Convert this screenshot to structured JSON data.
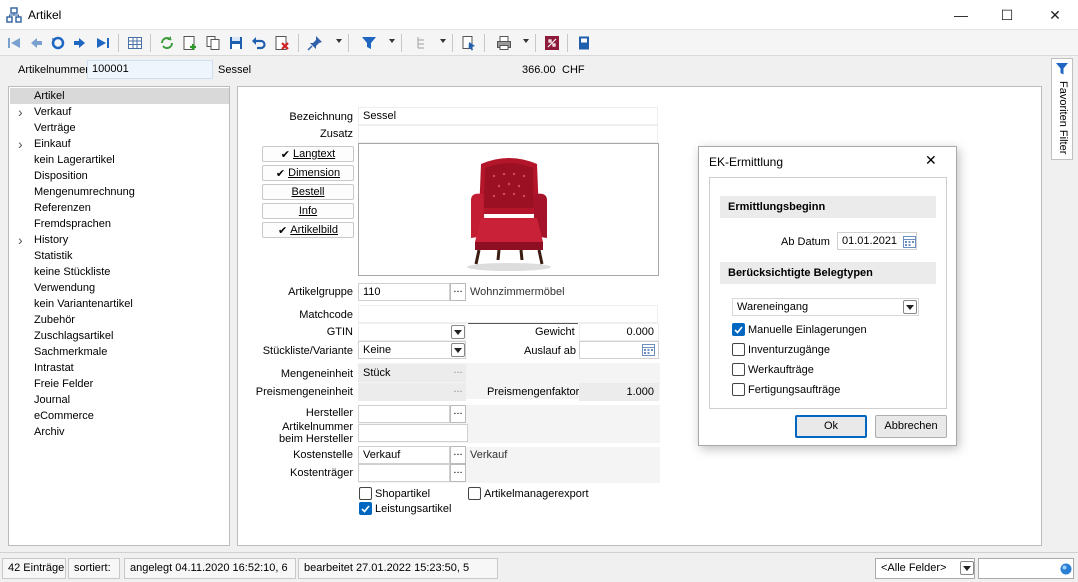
{
  "window": {
    "title": "Artikel",
    "minimize": "—",
    "maximize": "☐",
    "close": "✕"
  },
  "artikel": {
    "nummer_label": "Artikelnummer",
    "nummer": "100001",
    "name": "Sessel",
    "preis": "366.00",
    "waehrung": "CHF"
  },
  "nav": {
    "items": [
      {
        "label": "Artikel",
        "expand": false,
        "selected": true
      },
      {
        "label": "Verkauf",
        "expand": true
      },
      {
        "label": "Verträge",
        "expand": false
      },
      {
        "label": "Einkauf",
        "expand": true
      },
      {
        "label": "kein Lagerartikel",
        "expand": false
      },
      {
        "label": "Disposition",
        "expand": false
      },
      {
        "label": "Mengenumrechnung",
        "expand": false
      },
      {
        "label": "Referenzen",
        "expand": false
      },
      {
        "label": "Fremdsprachen",
        "expand": false
      },
      {
        "label": "History",
        "expand": true
      },
      {
        "label": "Statistik",
        "expand": false
      },
      {
        "label": "keine Stückliste",
        "expand": false
      },
      {
        "label": "Verwendung",
        "expand": false
      },
      {
        "label": "kein Variantenartikel",
        "expand": false
      },
      {
        "label": "Zubehör",
        "expand": false
      },
      {
        "label": "Zuschlagsartikel",
        "expand": false
      },
      {
        "label": "Sachmerkmale",
        "expand": false
      },
      {
        "label": "Intrastat",
        "expand": false
      },
      {
        "label": "Freie Felder",
        "expand": false
      },
      {
        "label": "Journal",
        "expand": false
      },
      {
        "label": "eCommerce",
        "expand": false
      },
      {
        "label": "Archiv",
        "expand": false
      }
    ]
  },
  "form": {
    "bezeichnung_label": "Bezeichnung",
    "bezeichnung": "Sessel",
    "zusatz_label": "Zusatz",
    "zusatz": "",
    "buttons": {
      "langtext": "Langtext",
      "dimension": "Dimension",
      "bestell": "Bestell",
      "info": "Info",
      "artikelbild": "Artikelbild"
    },
    "artikelgruppe_label": "Artikelgruppe",
    "artikelgruppe": "110",
    "artikelgruppe_text": "Wohnzimmermöbel",
    "matchcode_label": "Matchcode",
    "matchcode": "",
    "gtin_label": "GTIN",
    "gtin": "",
    "gewicht_label": "Gewicht",
    "gewicht": "0.000",
    "stueckliste_label": "Stückliste/Variante",
    "stueckliste": "Keine",
    "auslauf_label": "Auslauf ab",
    "auslauf": "",
    "mengeneinheit_label": "Mengeneinheit",
    "mengeneinheit": "Stück",
    "preismengeneinheit_label": "Preismengeneinheit",
    "preismengeneinheit": "",
    "preismengenfaktor_label": "Preismengenfaktor",
    "preismengenfaktor": "1.000",
    "hersteller_label": "Hersteller",
    "hersteller": "",
    "artnr_hersteller_label1": "Artikelnummer",
    "artnr_hersteller_label2": "beim Hersteller",
    "artnr_hersteller": "",
    "kostenstelle_label": "Kostenstelle",
    "kostenstelle": "Verkauf",
    "kostenstelle_text": "Verkauf",
    "kostentraeger_label": "Kostenträger",
    "kostentraeger": "",
    "shopartikel_label": "Shopartikel",
    "shopartikel": false,
    "artikelmanagerexport_label": "Artikelmanagerexport",
    "artikelmanagerexport": false,
    "leistungsartikel_label": "Leistungsartikel",
    "leistungsartikel": true,
    "dots": "..."
  },
  "dialog": {
    "title": "EK-Ermittlung",
    "section1": "Ermittlungsbeginn",
    "ab_datum_label": "Ab Datum",
    "ab_datum": "01.01.2021",
    "section2": "Berücksichtigte Belegtypen",
    "belegtyp": "Wareneingang",
    "checks": [
      {
        "label": "Manuelle Einlagerungen",
        "checked": true
      },
      {
        "label": "Inventurzugänge",
        "checked": false
      },
      {
        "label": "Werkaufträge",
        "checked": false
      },
      {
        "label": "Fertigungsaufträge",
        "checked": false
      }
    ],
    "ok": "Ok",
    "cancel": "Abbrechen"
  },
  "sidebar": {
    "favoriten": "Favoriten Filter"
  },
  "status": {
    "eintraege": "42 Einträge",
    "sortiert": "sortiert:",
    "angelegt": "angelegt 04.11.2020 16:52:10,  6",
    "bearbeitet": "bearbeitet 27.01.2022 15:23:50,  5",
    "felder": "<Alle Felder>",
    "search": ""
  },
  "colors": {
    "accent": "#0067c0",
    "red_chair": "#b3162a",
    "selected": "#d9d9d9"
  }
}
